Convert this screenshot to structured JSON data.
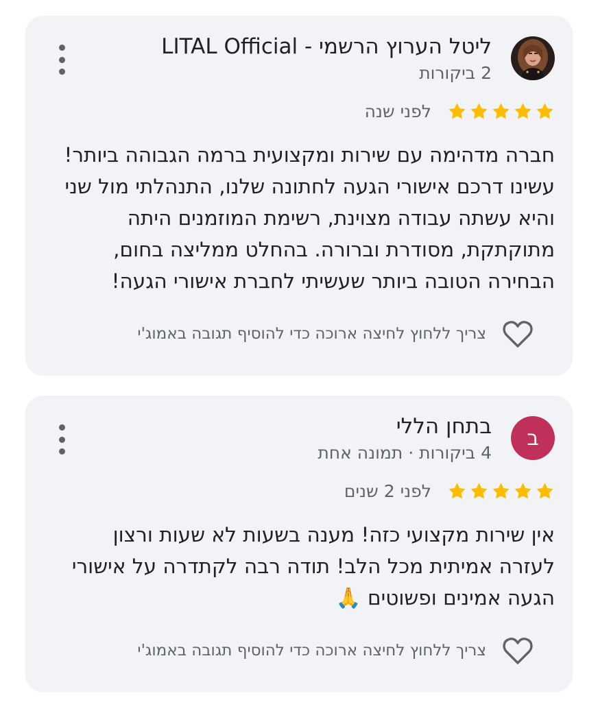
{
  "reviews": [
    {
      "author": "ליטל הערוץ הרשמי - LITAL Official",
      "meta": "2 ביקורות",
      "avatar": "photo",
      "stars": 5,
      "date": "לפני שנה",
      "body_lines": [
        "חברה מדהימה עם שירות ומקצועית ברמה הגבוהה ביותר!",
        "עשינו דרכם אישורי הגעה לחתונה שלנו, התנהלתי מול שני",
        "והיא עשתה עבודה מצוינת, רשימת המוזמנים היתה",
        "מתוקתקת, מסודרת וברורה. בהחלט ממליצה בחום,",
        "הבחירה הטובה ביותר שעשיתי לחברת אישורי הגעה!"
      ],
      "reaction_hint": "צריך ללחוץ לחיצה ארוכה כדי להוסיף תגובה באמוג'י"
    },
    {
      "author": "בתחן הללי",
      "meta": "4 ביקורות · תמונה אחת",
      "avatar": "letter",
      "avatar_letter": "ב",
      "stars": 5,
      "date": "לפני 2 שנים",
      "body_lines": [
        "אין שירות מקצועי כזה! מענה בשעות לא שעות ורצון",
        "לעזרה אמיתית מכל הלב! תודה רבה לקתדרה על אישורי",
        "הגעה אמינים ופשוטים 🙏"
      ],
      "reaction_hint": "צריך ללחוץ לחיצה ארוכה כדי להוסיף תגובה באמוג'י"
    }
  ],
  "icons": {
    "star": "star-icon",
    "heart": "heart-outline-icon",
    "menu": "more-vert-icon"
  },
  "colors": {
    "star": "#fbbc04",
    "card_bg": "#f2f3f6",
    "avatar_letter_bg": "#c0305a"
  }
}
